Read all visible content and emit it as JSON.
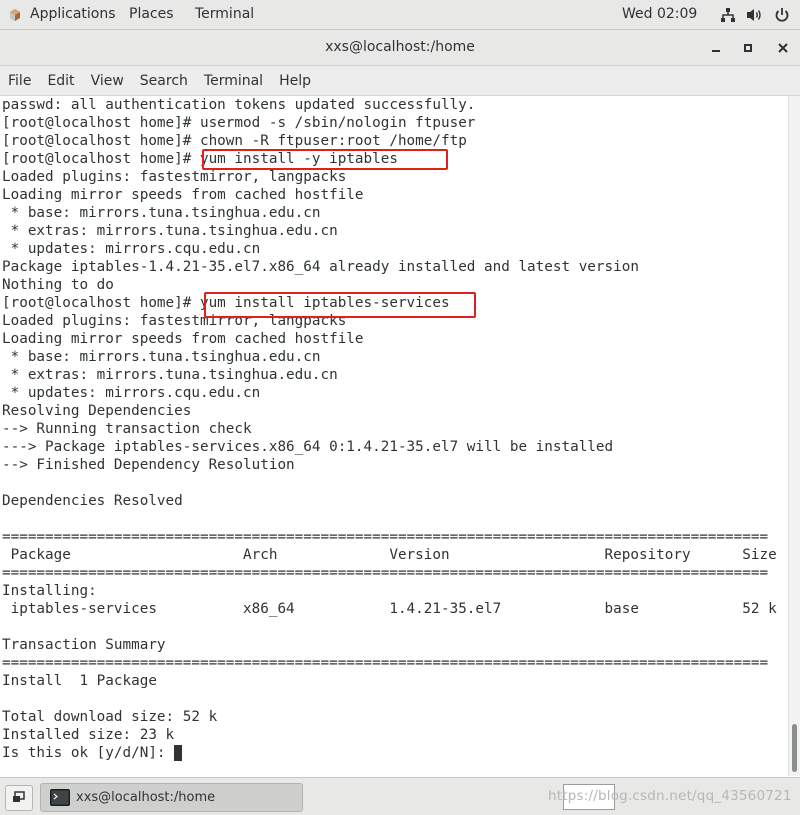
{
  "topbar": {
    "applications": "Applications",
    "places": "Places",
    "terminal": "Terminal",
    "clock": "Wed 02:09",
    "icons": [
      "network-icon",
      "volume-icon",
      "power-icon"
    ]
  },
  "window": {
    "title": "xxs@localhost:/home",
    "buttons": [
      "minimize-icon",
      "maximize-icon",
      "close-icon"
    ]
  },
  "menu": [
    "File",
    "Edit",
    "View",
    "Search",
    "Terminal",
    "Help"
  ],
  "terminal": {
    "lines": [
      "passwd: all authentication tokens updated successfully.",
      "[root@localhost home]# usermod -s /sbin/nologin ftpuser",
      "[root@localhost home]# chown -R ftpuser:root /home/ftp",
      "[root@localhost home]# yum install -y iptables",
      "Loaded plugins: fastestmirror, langpacks",
      "Loading mirror speeds from cached hostfile",
      " * base: mirrors.tuna.tsinghua.edu.cn",
      " * extras: mirrors.tuna.tsinghua.edu.cn",
      " * updates: mirrors.cqu.edu.cn",
      "Package iptables-1.4.21-35.el7.x86_64 already installed and latest version",
      "Nothing to do",
      "[root@localhost home]# yum install iptables-services",
      "Loaded plugins: fastestmirror, langpacks",
      "Loading mirror speeds from cached hostfile",
      " * base: mirrors.tuna.tsinghua.edu.cn",
      " * extras: mirrors.tuna.tsinghua.edu.cn",
      " * updates: mirrors.cqu.edu.cn",
      "Resolving Dependencies",
      "--> Running transaction check",
      "---> Package iptables-services.x86_64 0:1.4.21-35.el7 will be installed",
      "--> Finished Dependency Resolution",
      "",
      "Dependencies Resolved",
      "",
      "=========================================================================================",
      " Package                    Arch             Version                  Repository      Size",
      "=========================================================================================",
      "Installing:",
      " iptables-services          x86_64           1.4.21-35.el7            base            52 k",
      "",
      "Transaction Summary",
      "=========================================================================================",
      "Install  1 Package",
      "",
      "Total download size: 52 k",
      "Installed size: 23 k",
      "Is this ok [y/d/N]: "
    ],
    "highlighted_commands": [
      "yum install -y iptables",
      "yum install iptables-services"
    ],
    "highlight_color": "#e0201a",
    "text_color": "#2e3436"
  },
  "taskbar": {
    "task_label": "xxs@localhost:/home",
    "watermark": "https://blog.csdn.net/qq_43560721"
  }
}
